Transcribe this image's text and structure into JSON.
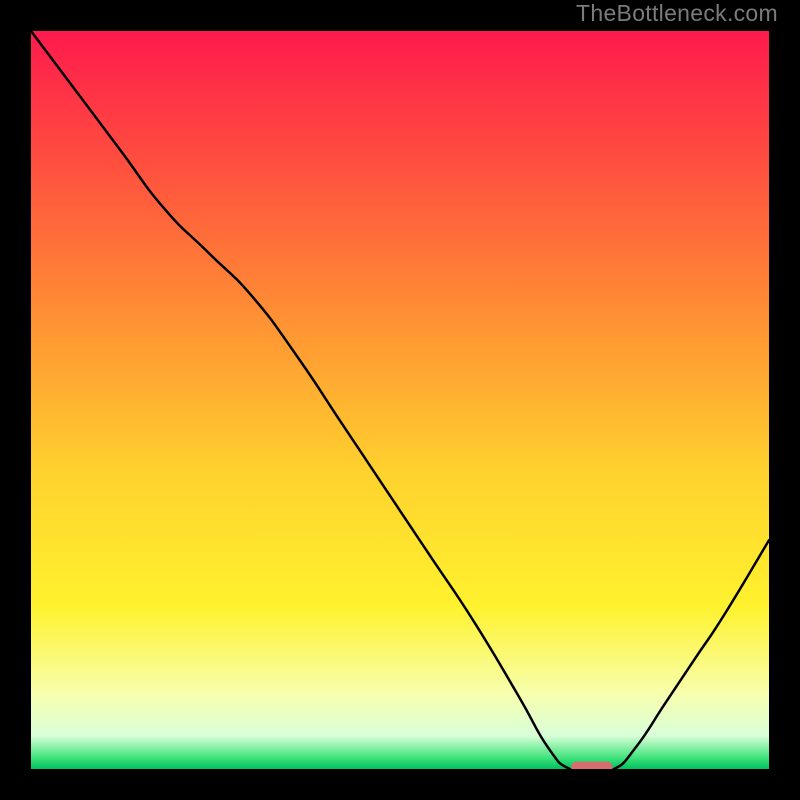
{
  "watermark": "TheBottleneck.com",
  "chart_data": {
    "type": "line",
    "title": "",
    "xlabel": "",
    "ylabel": "",
    "xlim": [
      0,
      100
    ],
    "ylim": [
      0,
      100
    ],
    "grid": false,
    "legend": false,
    "series": [
      {
        "name": "curve",
        "x": [
          0,
          6,
          12,
          18,
          24,
          30,
          36,
          42,
          48,
          54,
          60,
          66,
          70,
          73,
          76,
          79,
          82,
          86,
          90,
          94,
          100
        ],
        "y": [
          100,
          92,
          84,
          76,
          70,
          64,
          56,
          47,
          38,
          29,
          20,
          10,
          3,
          0,
          0,
          0,
          3,
          9,
          15,
          21,
          31
        ]
      }
    ],
    "marker": {
      "x_start": 73.2,
      "x_end": 78.8,
      "y": 0.25,
      "color": "#d76e6e"
    },
    "background_gradient": {
      "stops": [
        {
          "offset": 0.0,
          "color": "#ff1a4d"
        },
        {
          "offset": 0.18,
          "color": "#ff4f3f"
        },
        {
          "offset": 0.4,
          "color": "#ff9433"
        },
        {
          "offset": 0.6,
          "color": "#ffd22e"
        },
        {
          "offset": 0.78,
          "color": "#fff22e"
        },
        {
          "offset": 0.9,
          "color": "#f7ffb0"
        },
        {
          "offset": 0.955,
          "color": "#d8ffd8"
        },
        {
          "offset": 0.985,
          "color": "#3fe27a"
        },
        {
          "offset": 1.0,
          "color": "#00c060"
        }
      ]
    }
  }
}
